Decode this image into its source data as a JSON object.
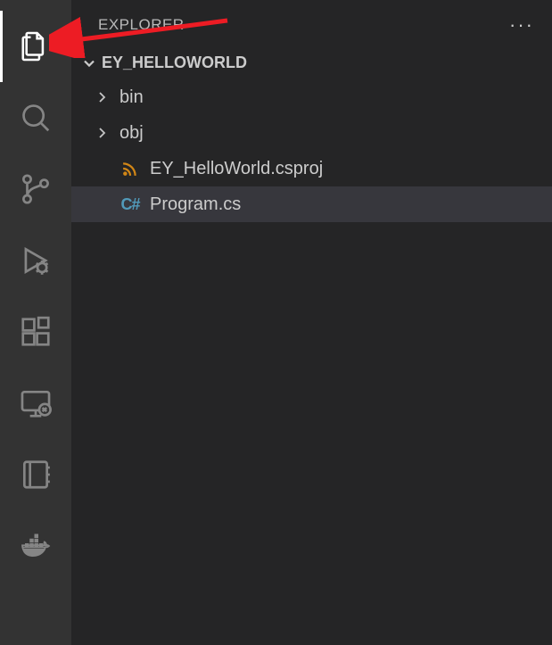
{
  "sidebar": {
    "title": "EXPLORER",
    "section": "EY_HELLOWORLD",
    "moreLabel": "···"
  },
  "tree": {
    "items": [
      {
        "kind": "folder",
        "label": "bin"
      },
      {
        "kind": "folder",
        "label": "obj"
      },
      {
        "kind": "file",
        "label": "EY_HelloWorld.csproj",
        "icon": "rss"
      },
      {
        "kind": "file",
        "label": "Program.cs",
        "icon": "csharp",
        "selected": true
      }
    ]
  },
  "activity": {
    "items": [
      {
        "name": "explorer",
        "active": true
      },
      {
        "name": "search"
      },
      {
        "name": "source-control"
      },
      {
        "name": "run-debug"
      },
      {
        "name": "extensions"
      },
      {
        "name": "remote-explorer"
      },
      {
        "name": "notebook"
      },
      {
        "name": "docker"
      }
    ]
  },
  "icons": {
    "csharpGlyph": "C#"
  }
}
